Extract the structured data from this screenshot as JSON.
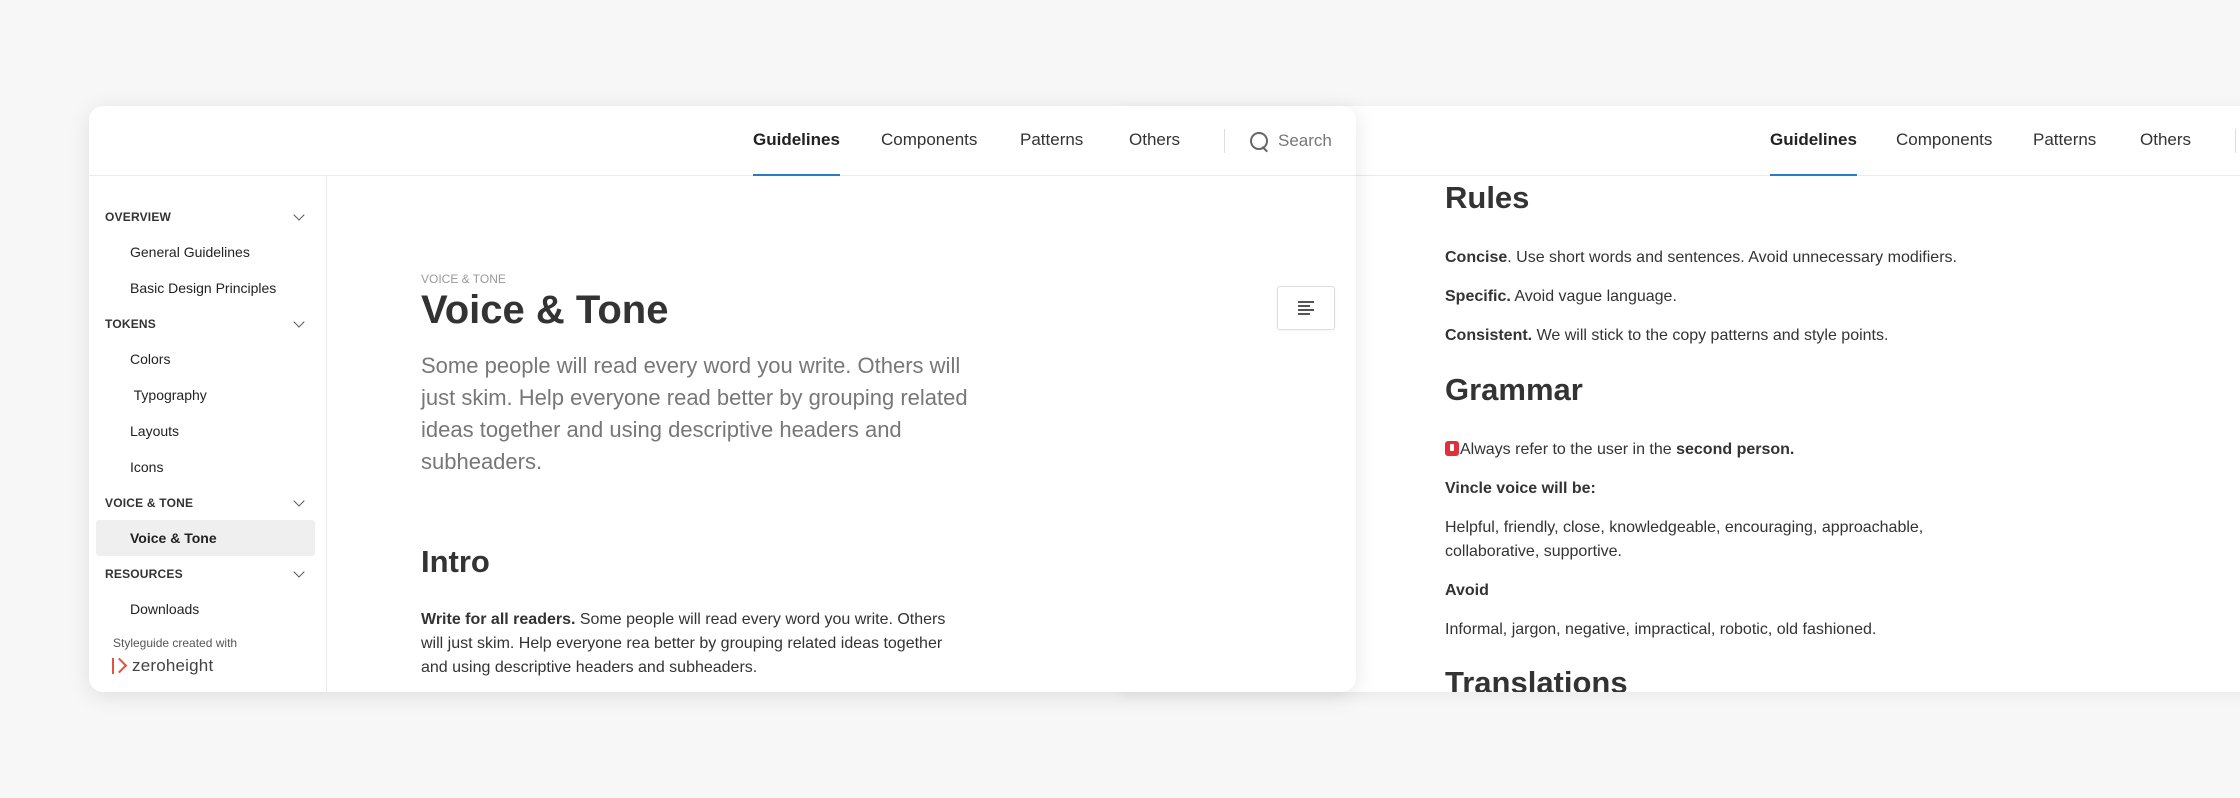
{
  "window2": {
    "tabs": [
      {
        "label": "Guidelines",
        "active": true
      },
      {
        "label": "Components"
      },
      {
        "label": "Patterns"
      },
      {
        "label": "Others"
      }
    ],
    "rules_title": "Rules",
    "rules": [
      {
        "term": "Concise",
        "text": ". Use short words and sentences. Avoid unnecessary modifiers."
      },
      {
        "term": "Specific.",
        "text": " Avoid vague language."
      },
      {
        "term": "Consistent.",
        "text": " We will stick to the copy patterns and style points."
      }
    ],
    "grammar_title": "Grammar",
    "grammar_note": {
      "prefix": "Always refer to the user in the ",
      "bold": "second person."
    },
    "voice_title": "Vincle voice will be:",
    "voice_text": "Helpful, friendly, close, knowledgeable, encouraging, approachable, collaborative, supportive.",
    "avoid_title": "Avoid",
    "avoid_text": "Informal, jargon, negative, impractical, robotic, old fashioned.",
    "translations_title": "Translations"
  },
  "window1": {
    "tabs": [
      {
        "label": "Guidelines",
        "active": true
      },
      {
        "label": "Components"
      },
      {
        "label": "Patterns"
      },
      {
        "label": "Others"
      }
    ],
    "search_label": "Search",
    "sidebar": {
      "sections": [
        {
          "title": "OVERVIEW",
          "items": [
            "General Guidelines",
            "Basic Design Principles"
          ]
        },
        {
          "title": "TOKENS",
          "items": [
            "Colors",
            " Typography",
            "Layouts",
            "Icons"
          ]
        },
        {
          "title": "VOICE & TONE",
          "items": [
            "Voice & Tone"
          ]
        },
        {
          "title": "RESOURCES",
          "items": [
            "Downloads"
          ]
        }
      ],
      "active_item": "Voice & Tone",
      "footer_label": "Styleguide created with",
      "brand": "zeroheight"
    },
    "main": {
      "eyebrow": "VOICE & TONE",
      "title": "Voice & Tone",
      "lead": "Some people will read every word you write. Others will just skim. Help everyone read better by grouping related ideas together and using descriptive headers and subheaders.",
      "intro_title": "Intro",
      "intro_bold": "Write for all readers.",
      "intro_text": " Some people will read every word you write. Others will just skim. Help everyone rea better by grouping related ideas together and using descriptive headers and subheaders."
    }
  }
}
